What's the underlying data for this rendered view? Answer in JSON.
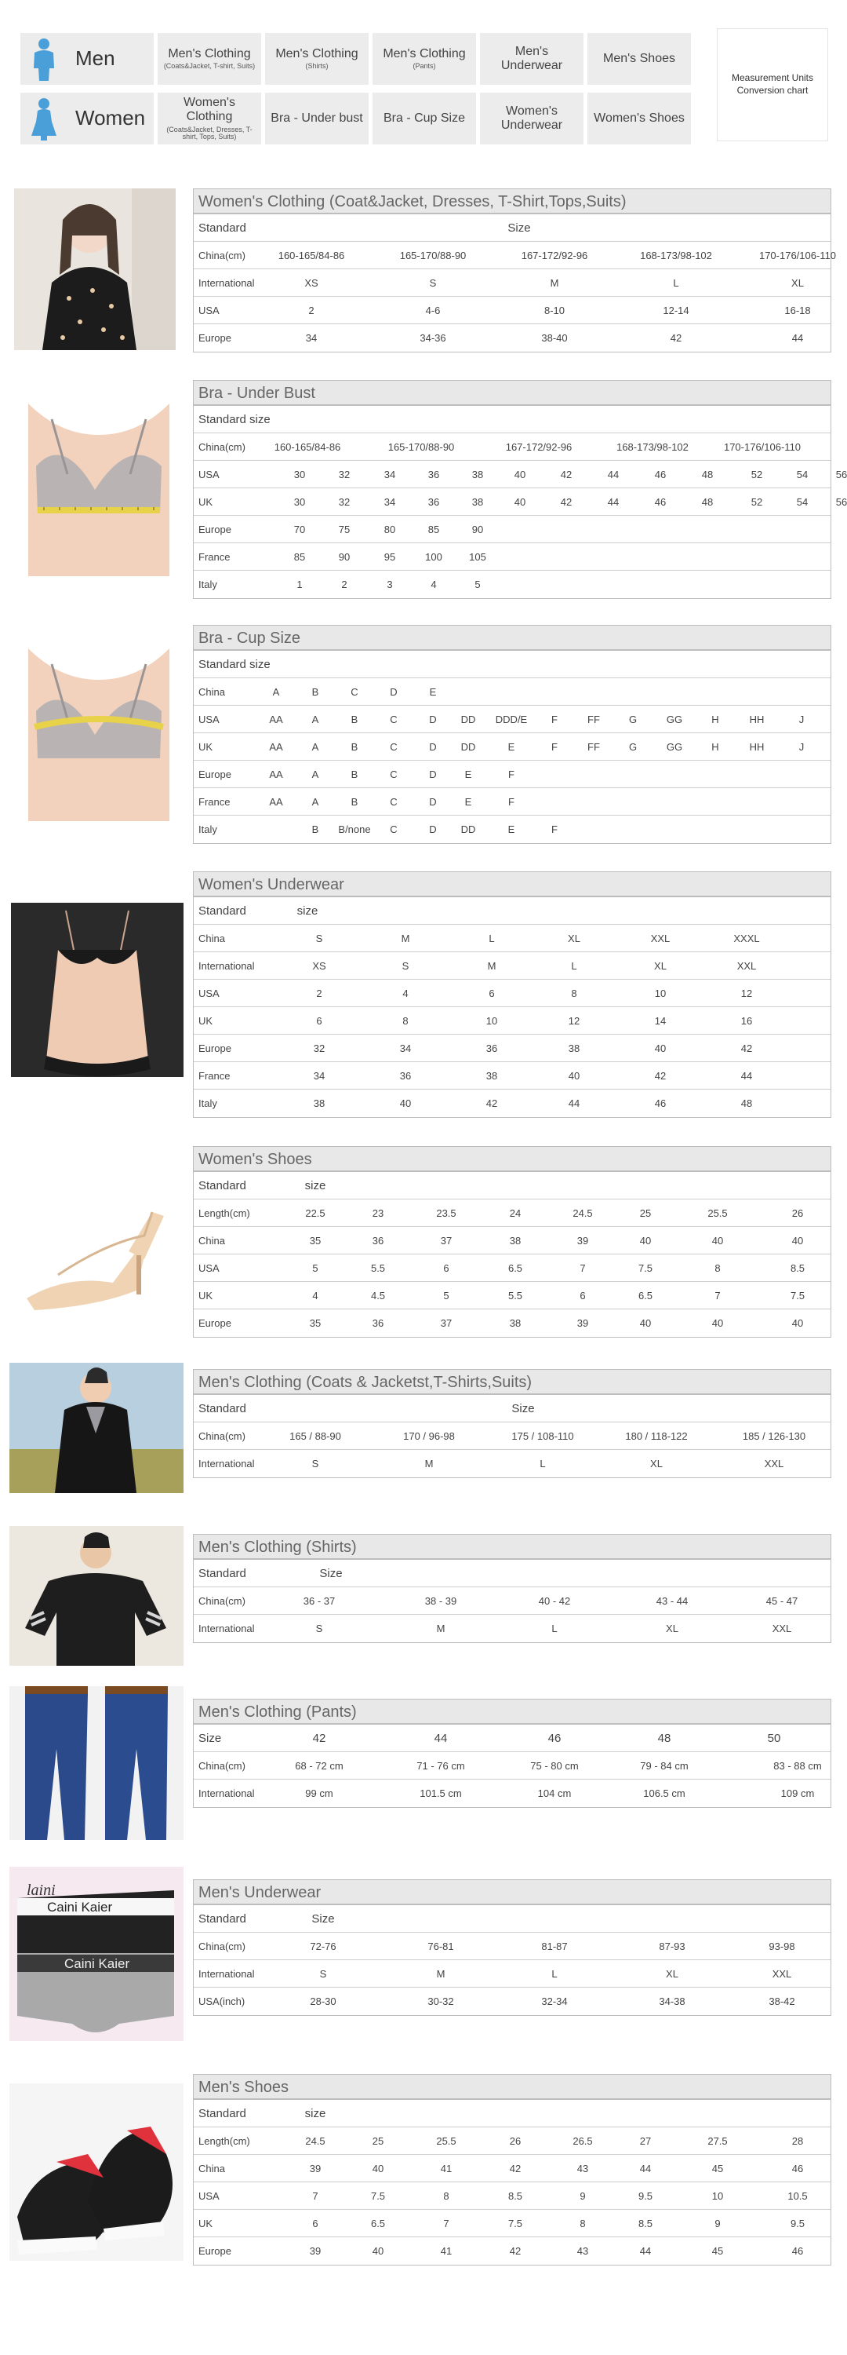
{
  "nav": {
    "men_label": "Men",
    "women_label": "Women",
    "men_items": [
      {
        "label": "Men's Clothing",
        "sub": "(Coats&Jacket, T-shirt, Suits)"
      },
      {
        "label": "Men's Clothing",
        "sub": "(Shirts)"
      },
      {
        "label": "Men's Clothing",
        "sub": "(Pants)"
      },
      {
        "label": "Men's Underwear",
        "sub": ""
      },
      {
        "label": "Men's Shoes",
        "sub": ""
      }
    ],
    "women_items": [
      {
        "label": "Women's Clothing",
        "sub": "(Coats&Jacket, Dresses, T-shirt, Tops, Suits)"
      },
      {
        "label": "Bra - Under bust",
        "sub": ""
      },
      {
        "label": "Bra - Cup Size",
        "sub": ""
      },
      {
        "label": "Women's Underwear",
        "sub": ""
      },
      {
        "label": "Women's Shoes",
        "sub": ""
      }
    ],
    "conversion_label": "Measurement Units Conversion chart",
    "colors": {
      "men_icon": "#4a9fd8",
      "women_icon": "#4a9fd8",
      "nav_bg": "#ececec"
    }
  },
  "tables": [
    {
      "title": "Women's Clothing (Coat&Jacket, Dresses, T-Shirt,Tops,Suits)",
      "sub": {
        "label": "Standard",
        "text": "Size"
      },
      "rows": [
        {
          "label": "China(cm)",
          "cells": [
            "160-165/84-86",
            "165-170/88-90",
            "167-172/92-96",
            "168-173/98-102",
            "170-176/106-110"
          ]
        },
        {
          "label": "International",
          "cells": [
            "XS",
            "S",
            "M",
            "L",
            "XL"
          ]
        },
        {
          "label": "USA",
          "cells": [
            "2",
            "4-6",
            "8-10",
            "12-14",
            "16-18"
          ]
        },
        {
          "label": "Europe",
          "cells": [
            "34",
            "34-36",
            "38-40",
            "42",
            "44"
          ]
        }
      ]
    },
    {
      "title": "Bra - Under Bust",
      "sub": {
        "label": "Standard size",
        "text": ""
      },
      "rows": [
        {
          "label": "China(cm)",
          "cells": [
            "160-165/84-86",
            "165-170/88-90",
            "167-172/92-96",
            "168-173/98-102",
            "170-176/106-110"
          ]
        },
        {
          "label": "USA",
          "cells": [
            "30",
            "32",
            "34",
            "36",
            "38",
            "40",
            "42",
            "44",
            "46",
            "48",
            "52",
            "54",
            "56"
          ]
        },
        {
          "label": "UK",
          "cells": [
            "30",
            "32",
            "34",
            "36",
            "38",
            "40",
            "42",
            "44",
            "46",
            "48",
            "52",
            "54",
            "56"
          ]
        },
        {
          "label": "Europe",
          "cells": [
            "70",
            "75",
            "80",
            "85",
            "90"
          ]
        },
        {
          "label": "France",
          "cells": [
            "85",
            "90",
            "95",
            "100",
            "105"
          ]
        },
        {
          "label": "Italy",
          "cells": [
            "1",
            "2",
            "3",
            "4",
            "5"
          ]
        }
      ]
    },
    {
      "title": "Bra - Cup Size",
      "sub": {
        "label": "Standard size",
        "text": ""
      },
      "rows": [
        {
          "label": "China",
          "cells": [
            "",
            "A",
            "B",
            "C",
            "D",
            "E"
          ]
        },
        {
          "label": "USA",
          "cells": [
            "AA",
            "A",
            "B",
            "C",
            "D",
            "DD",
            "DDD/E",
            "F",
            "FF",
            "G",
            "GG",
            "H",
            "HH",
            "J"
          ]
        },
        {
          "label": "UK",
          "cells": [
            "AA",
            "A",
            "B",
            "C",
            "D",
            "DD",
            "E",
            "F",
            "FF",
            "G",
            "GG",
            "H",
            "HH",
            "J"
          ]
        },
        {
          "label": "Europe",
          "cells": [
            "AA",
            "A",
            "B",
            "C",
            "D",
            "E",
            "F"
          ]
        },
        {
          "label": "France",
          "cells": [
            "AA",
            "A",
            "B",
            "C",
            "D",
            "E",
            "F"
          ]
        },
        {
          "label": "Italy",
          "cells": [
            "",
            "B",
            "B/none",
            "C",
            "D",
            "DD",
            "E",
            "F"
          ]
        }
      ]
    },
    {
      "title": "Women's Underwear",
      "sub": {
        "label": "Standard",
        "text": "size"
      },
      "rows": [
        {
          "label": "China",
          "cells": [
            "S",
            "M",
            "L",
            "XL",
            "XXL",
            "XXXL"
          ]
        },
        {
          "label": "International",
          "cells": [
            "XS",
            "S",
            "M",
            "L",
            "XL",
            "XXL"
          ]
        },
        {
          "label": "USA",
          "cells": [
            "2",
            "4",
            "6",
            "8",
            "10",
            "12"
          ]
        },
        {
          "label": "UK",
          "cells": [
            "6",
            "8",
            "10",
            "12",
            "14",
            "16"
          ]
        },
        {
          "label": "Europe",
          "cells": [
            "32",
            "34",
            "36",
            "38",
            "40",
            "42"
          ]
        },
        {
          "label": "France",
          "cells": [
            "34",
            "36",
            "38",
            "40",
            "42",
            "44"
          ]
        },
        {
          "label": "Italy",
          "cells": [
            "38",
            "40",
            "42",
            "44",
            "46",
            "48"
          ]
        }
      ]
    },
    {
      "title": "Women's Shoes",
      "sub": {
        "label": "Standard",
        "text": "size"
      },
      "rows": [
        {
          "label": "Length(cm)",
          "cells": [
            "22.5",
            "23",
            "23.5",
            "24",
            "24.5",
            "25",
            "25.5",
            "26"
          ]
        },
        {
          "label": "China",
          "cells": [
            "35",
            "36",
            "37",
            "38",
            "39",
            "40",
            "40",
            "40"
          ]
        },
        {
          "label": "USA",
          "cells": [
            "5",
            "5.5",
            "6",
            "6.5",
            "7",
            "7.5",
            "8",
            "8.5"
          ]
        },
        {
          "label": "UK",
          "cells": [
            "4",
            "4.5",
            "5",
            "5.5",
            "6",
            "6.5",
            "7",
            "7.5"
          ]
        },
        {
          "label": "Europe",
          "cells": [
            "35",
            "36",
            "37",
            "38",
            "39",
            "40",
            "40",
            "40"
          ]
        }
      ]
    },
    {
      "title": "Men's Clothing (Coats & Jacketst,T-Shirts,Suits)",
      "sub": {
        "label": "Standard",
        "text": "Size"
      },
      "rows": [
        {
          "label": "China(cm)",
          "cells": [
            "165 / 88-90",
            "170 / 96-98",
            "175 / 108-110",
            "180 / 118-122",
            "185 / 126-130"
          ]
        },
        {
          "label": "International",
          "cells": [
            "S",
            "M",
            "L",
            "XL",
            "XXL"
          ]
        }
      ]
    },
    {
      "title": "Men's Clothing (Shirts)",
      "sub": {
        "label": "Standard",
        "text": "Size"
      },
      "rows": [
        {
          "label": "China(cm)",
          "cells": [
            "36 - 37",
            "38 - 39",
            "40 - 42",
            "43 -  44",
            "45 - 47"
          ]
        },
        {
          "label": "International",
          "cells": [
            "S",
            "M",
            "L",
            "XL",
            "XXL"
          ]
        }
      ]
    },
    {
      "title": "Men's Clothing (Pants)",
      "sub": {
        "label": "Size",
        "text": "",
        "cells": [
          "42",
          "44",
          "46",
          "48",
          "50"
        ]
      },
      "rows": [
        {
          "label": "China(cm)",
          "cells": [
            "68 - 72 cm",
            "71 - 76 cm",
            "75 - 80 cm",
            "79 - 84 cm",
            "83 - 88 cm"
          ]
        },
        {
          "label": "International",
          "cells": [
            "99 cm",
            "101.5 cm",
            "104 cm",
            "106.5 cm",
            "109 cm"
          ]
        }
      ]
    },
    {
      "title": "Men's Underwear",
      "sub": {
        "label": "Standard",
        "text": "Size"
      },
      "rows": [
        {
          "label": "China(cm)",
          "cells": [
            "72-76",
            "76-81",
            "81-87",
            "87-93",
            "93-98"
          ]
        },
        {
          "label": "International",
          "cells": [
            "S",
            "M",
            "L",
            "XL",
            "XXL"
          ]
        },
        {
          "label": "USA(inch)",
          "cells": [
            "28-30",
            "30-32",
            "32-34",
            "34-38",
            "38-42"
          ]
        }
      ]
    },
    {
      "title": "Men's Shoes",
      "sub": {
        "label": "Standard",
        "text": "size"
      },
      "rows": [
        {
          "label": "Length(cm)",
          "cells": [
            "24.5",
            "25",
            "25.5",
            "26",
            "26.5",
            "27",
            "27.5",
            "28"
          ]
        },
        {
          "label": "China",
          "cells": [
            "39",
            "40",
            "41",
            "42",
            "43",
            "44",
            "45",
            "46"
          ]
        },
        {
          "label": "USA",
          "cells": [
            "7",
            "7.5",
            "8",
            "8.5",
            "9",
            "9.5",
            "10",
            "10.5"
          ]
        },
        {
          "label": "UK",
          "cells": [
            "6",
            "6.5",
            "7",
            "7.5",
            "8",
            "8.5",
            "9",
            "9.5"
          ]
        },
        {
          "label": "Europe",
          "cells": [
            "39",
            "40",
            "41",
            "42",
            "43",
            "44",
            "45",
            "46"
          ]
        }
      ]
    }
  ],
  "images": {
    "underwear_brand": "Caini Kaier",
    "underwear_brand_script": "laini"
  }
}
